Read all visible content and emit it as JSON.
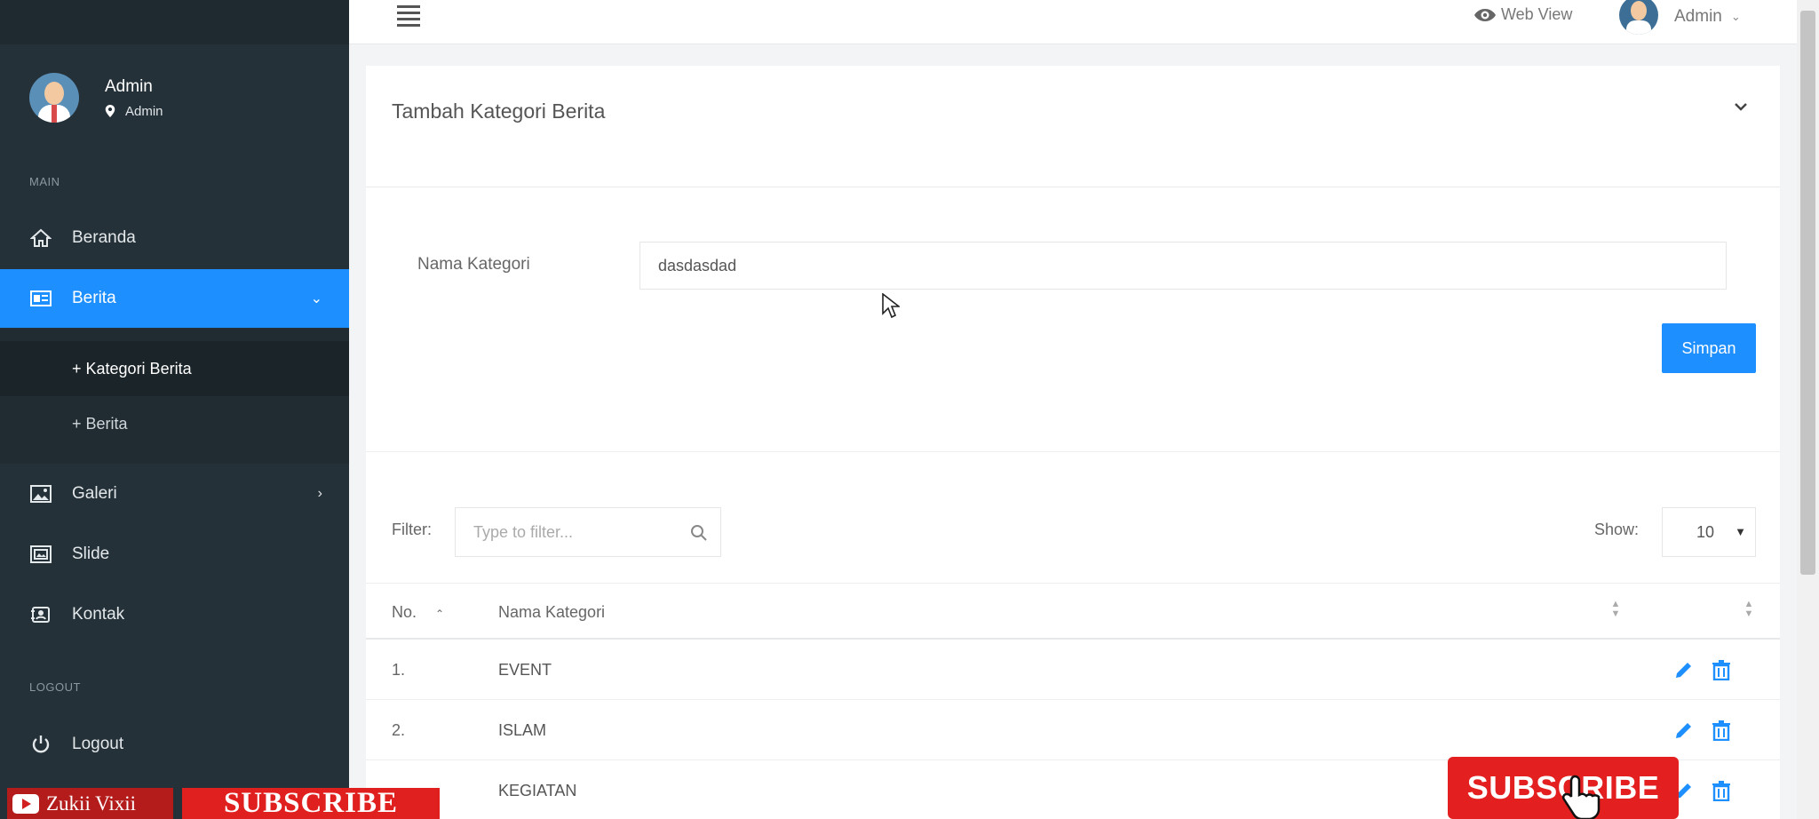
{
  "sidebar": {
    "user": {
      "name": "Admin",
      "role": "Admin"
    },
    "section_main": "MAIN",
    "items": [
      {
        "label": "Beranda",
        "icon": "home-icon"
      },
      {
        "label": "Berita",
        "icon": "news-icon",
        "active": true
      },
      {
        "label": "Galeri",
        "icon": "image-icon"
      },
      {
        "label": "Slide",
        "icon": "slides-icon"
      },
      {
        "label": "Kontak",
        "icon": "contact-icon"
      }
    ],
    "sub_items": [
      {
        "label": "+ Kategori Berita",
        "current": true
      },
      {
        "label": "+ Berita"
      }
    ],
    "section_logout": "LOGOUT",
    "logout": {
      "label": "Logout",
      "icon": "power-icon"
    }
  },
  "topbar": {
    "web_view": "Web View",
    "user_name": "Admin"
  },
  "panel": {
    "title": "Tambah Kategori Berita",
    "form": {
      "label": "Nama Kategori",
      "value": "dasdasdad",
      "save_label": "Simpan"
    },
    "filter": {
      "label": "Filter:",
      "placeholder": "Type to filter...",
      "show_label": "Show:",
      "show_value": "10"
    },
    "table": {
      "columns": [
        "No.",
        "Nama Kategori"
      ],
      "rows": [
        {
          "no": "1.",
          "name": "EVENT"
        },
        {
          "no": "2.",
          "name": "ISLAM"
        },
        {
          "no": "",
          "name": "KEGIATAN"
        }
      ]
    }
  },
  "overlay": {
    "channel": "Zukii Vixii",
    "subscribe_banner": "SUBSCRIBE",
    "subscribe_button": "SUBSCRIBE"
  },
  "colors": {
    "sidebar_bg": "#253138",
    "accent": "#1e8fff",
    "subscribe_red": "#e3201f"
  }
}
